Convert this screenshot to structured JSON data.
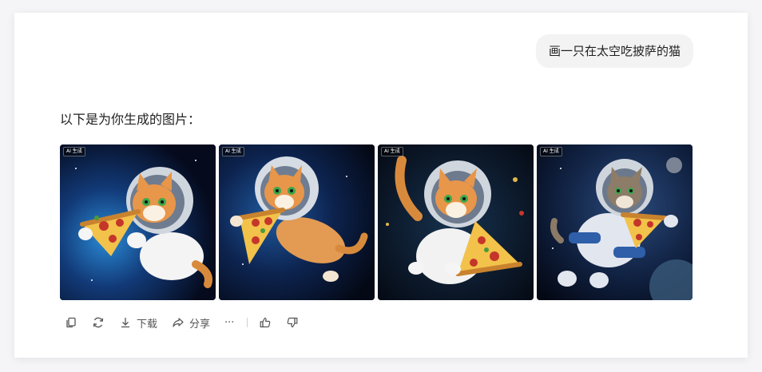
{
  "conversation": {
    "user_message": "画一只在太空吃披萨的猫",
    "assistant_intro": "以下是为你生成的图片："
  },
  "images": [
    {
      "badge": "AI 生成",
      "subject": "cat-astronaut-eating-pizza",
      "variant": 1
    },
    {
      "badge": "AI 生成",
      "subject": "cat-astronaut-eating-pizza",
      "variant": 2
    },
    {
      "badge": "AI 生成",
      "subject": "cat-astronaut-eating-pizza",
      "variant": 3
    },
    {
      "badge": "AI 生成",
      "subject": "cat-astronaut-eating-pizza",
      "variant": 4
    }
  ],
  "toolbar": {
    "copy_icon": "copy-icon",
    "regenerate_icon": "refresh-icon",
    "download_label": "下载",
    "share_label": "分享",
    "more_label": "···",
    "like_icon": "thumbs-up-icon",
    "dislike_icon": "thumbs-down-icon"
  },
  "colors": {
    "card_bg": "#ffffff",
    "page_bg": "#f5f5f7",
    "bubble_bg": "#f3f3f4",
    "text": "#222222",
    "toolbar_text": "#555555"
  }
}
